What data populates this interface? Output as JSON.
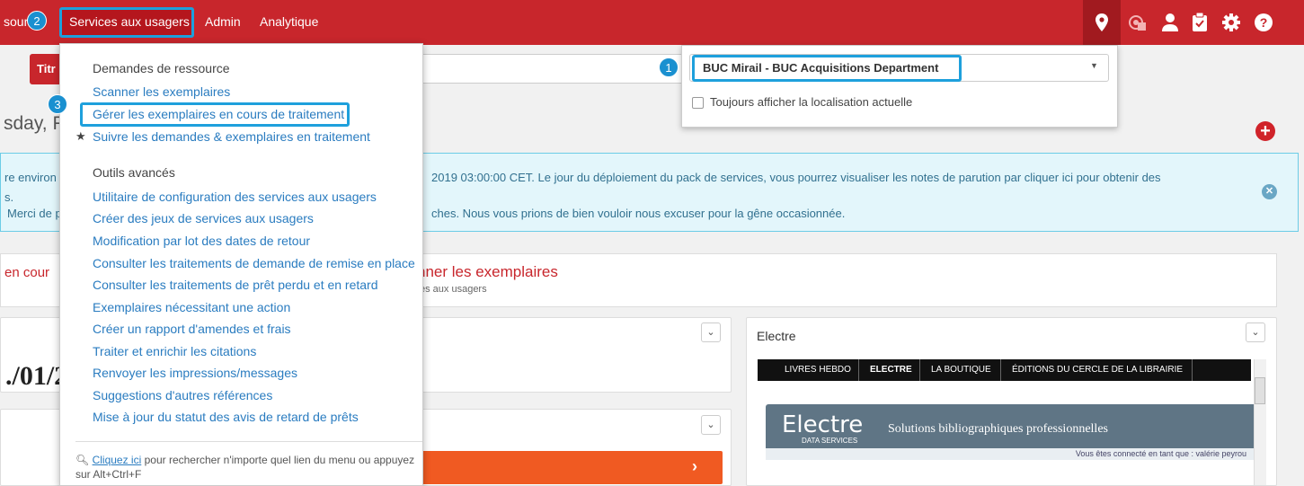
{
  "topbar": {
    "resources_partial": "sour",
    "services_label": "Services aux usagers",
    "admin_label": "Admin",
    "analytics_label": "Analytique",
    "badge_2": "2",
    "badge_1": "1",
    "badge_3": "3"
  },
  "page": {
    "title_button_partial": "Titr",
    "date_heading_partial": "sday, Fe",
    "notice": {
      "line1_left": "re environ",
      "line1_right": "2019 03:00:00 CET. Le jour du déploiement du pack de services, vous pourrez visualiser les notes de parution par cliquer ici pour obtenir des",
      "line2_left": "s.",
      "line3_left": "Merci de p",
      "line3_right": "ches. Nous vous prions de bien vouloir nous excuser pour la gêne occasionnée."
    },
    "tile_left_partial": "en cour",
    "tile_scan_title": "nner les exemplaires",
    "tile_scan_sub": "es aux usagers",
    "big_date_partial": "./01/2"
  },
  "electre": {
    "title": "Electre",
    "nav": [
      "LIVRES HEBDO",
      "ELECTRE",
      "LA BOUTIQUE",
      "ÉDITIONS DU CERCLE DE LA LIBRAIRIE"
    ],
    "logo": "Electre",
    "logo_sub": "DATA SERVICES",
    "tagline": "Solutions bibliographiques professionnelles",
    "user_line": "Vous êtes connecté en tant que : valérie peyrou"
  },
  "location": {
    "selected": "BUC Mirail - BUC Acquisitions Department",
    "checkbox_label": "Toujours afficher la localisation actuelle"
  },
  "services_menu": {
    "section1": "Demandes de ressource",
    "items1": [
      "Scanner les exemplaires",
      "Gérer les exemplaires en cours de traitement",
      "Suivre les demandes & exemplaires en traitement"
    ],
    "section2": "Outils avancés",
    "items2": [
      "Utilitaire de configuration des services aux usagers",
      "Créer des jeux de services aux usagers",
      "Modification par lot des dates de retour",
      "Consulter les traitements de demande de remise en place",
      "Consulter les traitements de prêt perdu et en retard",
      "Exemplaires nécessitant une action",
      "Créer un rapport d'amendes et frais",
      "Traiter et enrichir les citations",
      "Renvoyer les impressions/messages",
      "Suggestions d'autres références",
      "Mise à jour du statut des avis de retard de prêts"
    ],
    "footer_link": "Cliquez ici",
    "footer_text": " pour rechercher n'importe quel lien du menu ou appuyez sur Alt+Ctrl+F"
  },
  "colors": {
    "brand_red": "#c8262c",
    "highlight_blue": "#1ea0dc",
    "link_blue": "#2a7cc0",
    "notice_bg": "#e3f6fb"
  }
}
